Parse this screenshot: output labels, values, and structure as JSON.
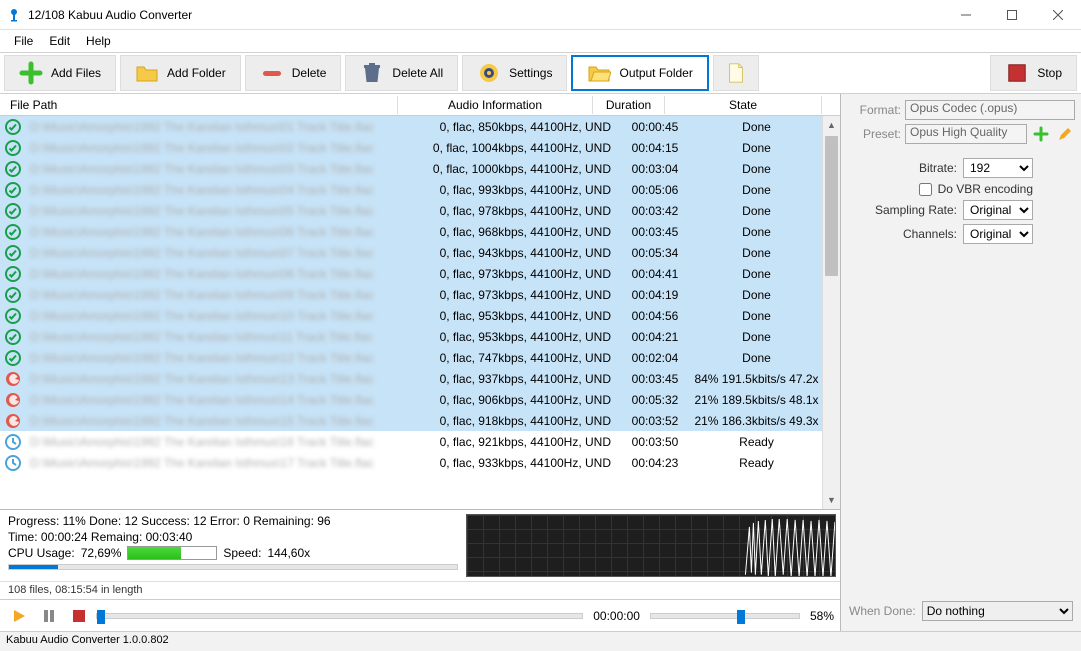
{
  "window": {
    "title": "12/108 Kabuu Audio Converter"
  },
  "menu": {
    "file": "File",
    "edit": "Edit",
    "help": "Help"
  },
  "toolbar": {
    "add_files": "Add Files",
    "add_folder": "Add Folder",
    "delete": "Delete",
    "delete_all": "Delete All",
    "settings": "Settings",
    "output_folder": "Output Folder",
    "stop": "Stop"
  },
  "columns": {
    "path": "File Path",
    "info": "Audio Information",
    "duration": "Duration",
    "state": "State"
  },
  "rows": [
    {
      "status": "done",
      "info": "0, flac, 850kbps, 44100Hz, UND",
      "dur": "00:00:45",
      "state": "Done"
    },
    {
      "status": "done",
      "info": "0, flac, 1004kbps, 44100Hz, UND",
      "dur": "00:04:15",
      "state": "Done"
    },
    {
      "status": "done",
      "info": "0, flac, 1000kbps, 44100Hz, UND",
      "dur": "00:03:04",
      "state": "Done"
    },
    {
      "status": "done",
      "info": "0, flac, 993kbps, 44100Hz, UND",
      "dur": "00:05:06",
      "state": "Done"
    },
    {
      "status": "done",
      "info": "0, flac, 978kbps, 44100Hz, UND",
      "dur": "00:03:42",
      "state": "Done"
    },
    {
      "status": "done",
      "info": "0, flac, 968kbps, 44100Hz, UND",
      "dur": "00:03:45",
      "state": "Done"
    },
    {
      "status": "done",
      "info": "0, flac, 943kbps, 44100Hz, UND",
      "dur": "00:05:34",
      "state": "Done"
    },
    {
      "status": "done",
      "info": "0, flac, 973kbps, 44100Hz, UND",
      "dur": "00:04:41",
      "state": "Done"
    },
    {
      "status": "done",
      "info": "0, flac, 973kbps, 44100Hz, UND",
      "dur": "00:04:19",
      "state": "Done"
    },
    {
      "status": "done",
      "info": "0, flac, 953kbps, 44100Hz, UND",
      "dur": "00:04:56",
      "state": "Done"
    },
    {
      "status": "done",
      "info": "0, flac, 953kbps, 44100Hz, UND",
      "dur": "00:04:21",
      "state": "Done"
    },
    {
      "status": "done",
      "info": "0, flac, 747kbps, 44100Hz, UND",
      "dur": "00:02:04",
      "state": "Done"
    },
    {
      "status": "working",
      "info": "0, flac, 937kbps, 44100Hz, UND",
      "dur": "00:03:45",
      "state": "84% 191.5kbits/s 47.2x"
    },
    {
      "status": "working",
      "info": "0, flac, 906kbps, 44100Hz, UND",
      "dur": "00:05:32",
      "state": "21% 189.5kbits/s 48.1x"
    },
    {
      "status": "working",
      "info": "0, flac, 918kbps, 44100Hz, UND",
      "dur": "00:03:52",
      "state": "21% 186.3kbits/s 49.3x"
    },
    {
      "status": "ready",
      "info": "0, flac, 921kbps, 44100Hz, UND",
      "dur": "00:03:50",
      "state": "Ready"
    },
    {
      "status": "ready",
      "info": "0, flac, 933kbps, 44100Hz, UND",
      "dur": "00:04:23",
      "state": "Ready"
    }
  ],
  "progress": {
    "line1": "Progress: 11% Done: 12 Success: 12 Error: 0 Remaining: 96",
    "line2": "Time: 00:00:24 Remaing: 00:03:40",
    "cpu_label": "CPU Usage:",
    "cpu_value": "72,69%",
    "speed_label": "Speed:",
    "speed_value": "144,60x",
    "percent": 11
  },
  "filecount": "108 files, 08:15:54 in length",
  "playbar": {
    "time": "00:00:00",
    "volume": "58%"
  },
  "settings": {
    "format_label": "Format:",
    "format_value": "Opus Codec (.opus)",
    "preset_label": "Preset:",
    "preset_value": "Opus High Quality",
    "bitrate_label": "Bitrate:",
    "bitrate_value": "192",
    "vbr_label": "Do VBR encoding",
    "sampling_label": "Sampling Rate:",
    "sampling_value": "Original",
    "channels_label": "Channels:",
    "channels_value": "Original"
  },
  "whendone": {
    "label": "When Done:",
    "value": "Do nothing"
  },
  "statusbar": "Kabuu Audio Converter 1.0.0.802"
}
